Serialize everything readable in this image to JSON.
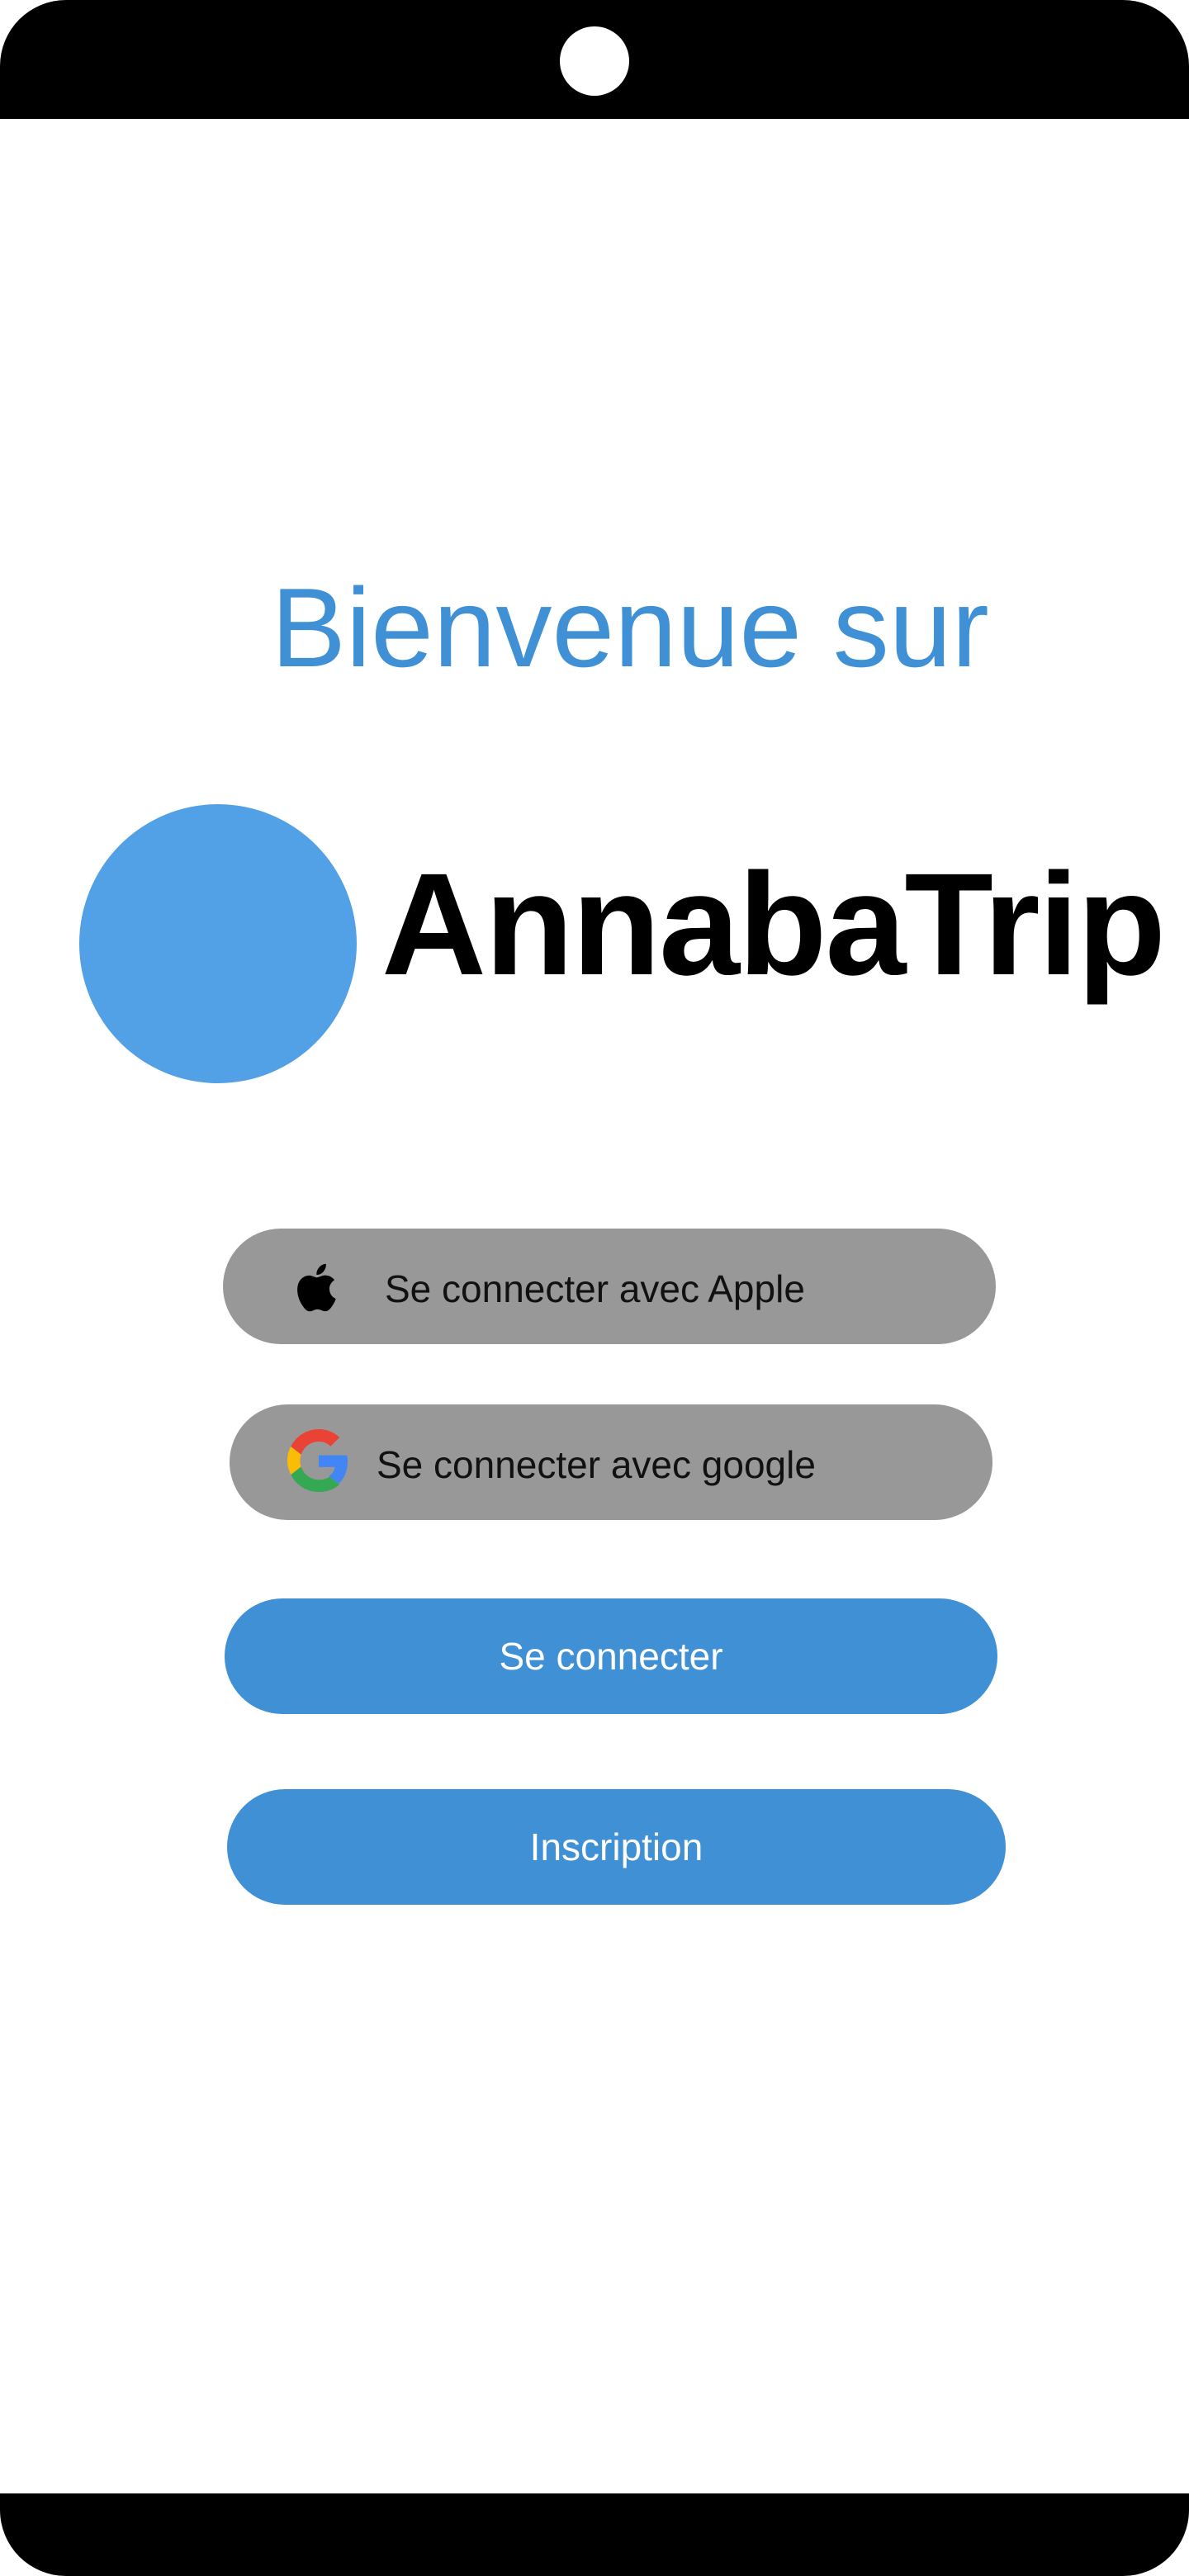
{
  "colors": {
    "accent": "#3f90d4",
    "logo_circle": "#52a0e6",
    "social_button_bg": "#999898"
  },
  "welcome": {
    "title": "Bienvenue sur"
  },
  "brand": {
    "name": "AnnabaTrip"
  },
  "buttons": {
    "apple": {
      "label": "Se connecter avec Apple",
      "icon": "apple-icon"
    },
    "google": {
      "label": "Se connecter avec google",
      "icon": "google-icon"
    },
    "login": {
      "label": "Se connecter"
    },
    "signup": {
      "label": "Inscription"
    }
  }
}
